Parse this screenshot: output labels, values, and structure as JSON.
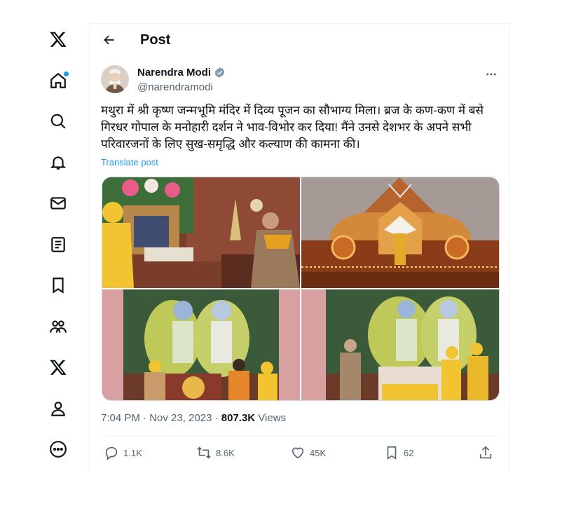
{
  "sidebar": {
    "items": [
      {
        "icon": "x-logo-icon"
      },
      {
        "icon": "home-icon"
      },
      {
        "icon": "explore-search-icon"
      },
      {
        "icon": "notifications-bell-icon"
      },
      {
        "icon": "messages-envelope-icon"
      },
      {
        "icon": "lists-icon"
      },
      {
        "icon": "bookmarks-icon"
      },
      {
        "icon": "communities-icon"
      },
      {
        "icon": "premium-x-icon"
      },
      {
        "icon": "profile-icon"
      },
      {
        "icon": "more-circle-icon"
      }
    ]
  },
  "header": {
    "title": "Post"
  },
  "post": {
    "author": {
      "name": "Narendra Modi",
      "handle": "@narendramodi",
      "verified": true
    },
    "text": "मथुरा में श्री कृष्ण जन्मभूमि मंदिर में दिव्य पूजन का सौभाग्य मिला। ब्रज के कण-कण में बसे गिरधर गोपाल के मनोहारी दर्शन ने भाव-विभोर कर दिया! मैंने उनसे देशभर के अपने सभी परिवारजनों के लिए सुख-समृद्धि और कल्याण की कामना की।",
    "translate_label": "Translate post",
    "time": "7:04 PM · Nov 23, 2023 · ",
    "views_count": "807.3K",
    "views_label": " Views",
    "actions": {
      "replies": "1.1K",
      "reposts": "8.6K",
      "likes": "45K",
      "bookmarks": "62"
    }
  },
  "colors": {
    "accent": "#1d9bf0",
    "muted": "#536471",
    "text": "#0f1419"
  }
}
